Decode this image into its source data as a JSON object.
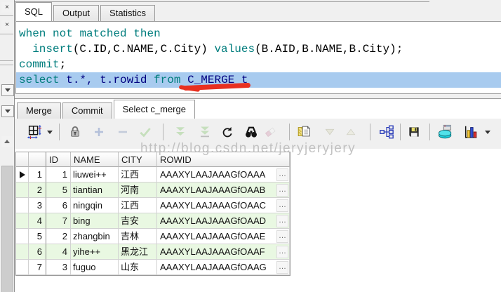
{
  "top_tabs": {
    "items": [
      {
        "label": "SQL",
        "active": true
      },
      {
        "label": "Output",
        "active": false
      },
      {
        "label": "Statistics",
        "active": false
      }
    ]
  },
  "editor": {
    "colors": {
      "keyword": "#007d7d",
      "identifier": "#000000",
      "selected_identifier": "#000080",
      "selection_bg": "#a8cbef",
      "marker_red": "#e83020"
    },
    "lines": [
      {
        "selected": false,
        "tokens": [
          [
            "when",
            "kw"
          ],
          [
            " ",
            "pl"
          ],
          [
            "not",
            "kw"
          ],
          [
            " ",
            "pl"
          ],
          [
            "matched",
            "kw"
          ],
          [
            " ",
            "pl"
          ],
          [
            "then",
            "kw"
          ]
        ]
      },
      {
        "selected": false,
        "tokens": [
          [
            "  ",
            "pl"
          ],
          [
            "insert",
            "kw"
          ],
          [
            "(C.ID,C.NAME,C.City) ",
            "pl"
          ],
          [
            "values",
            "kw"
          ],
          [
            "(B.AID,B.NAME,B.City);",
            "pl"
          ]
        ]
      },
      {
        "selected": false,
        "tokens": [
          [
            "commit",
            "kw"
          ],
          [
            ";",
            "pl"
          ]
        ]
      },
      {
        "selected": true,
        "tokens": [
          [
            "select",
            "kw"
          ],
          [
            " ",
            "nv"
          ],
          [
            "t.*, t.rowid ",
            "nv"
          ],
          [
            "from",
            "kw"
          ],
          [
            " ",
            "nv"
          ],
          [
            "C_MERGE t",
            "nv"
          ]
        ]
      }
    ],
    "annotation": {
      "shape": "hand-drawn-underline",
      "under_text": "C_MERGE"
    }
  },
  "result_tabs": {
    "items": [
      {
        "label": "Merge",
        "active": false
      },
      {
        "label": "Commit",
        "active": false
      },
      {
        "label": "Select c_merge",
        "active": true
      }
    ]
  },
  "toolbar": {
    "buttons": [
      {
        "icon": "grid-layout-icon",
        "enabled": true,
        "dropdown": true
      },
      {
        "icon": "lock-icon",
        "enabled": true
      },
      {
        "icon": "add-record-icon",
        "enabled": false
      },
      {
        "icon": "delete-record-icon",
        "enabled": false
      },
      {
        "icon": "post-changes-icon",
        "enabled": false
      },
      {
        "icon": "fetch-next-page-icon",
        "enabled": false
      },
      {
        "icon": "fetch-last-page-icon",
        "enabled": false
      },
      {
        "icon": "refresh-icon",
        "enabled": true
      },
      {
        "icon": "find-icon",
        "enabled": true
      },
      {
        "icon": "erase-icon",
        "enabled": false
      },
      {
        "icon": "copy-results-icon",
        "enabled": true
      },
      {
        "icon": "sort-descending-icon",
        "enabled": false
      },
      {
        "icon": "sort-ascending-icon",
        "enabled": false
      },
      {
        "icon": "single-record-view-icon",
        "enabled": true
      },
      {
        "icon": "save-results-icon",
        "enabled": true
      },
      {
        "icon": "export-results-icon",
        "enabled": true
      },
      {
        "icon": "chart-icon",
        "enabled": true,
        "dropdown": true
      }
    ]
  },
  "watermark": {
    "text": "http://blog.csdn.net/jeryjeryjery"
  },
  "grid": {
    "headers": [
      "ID",
      "NAME",
      "CITY",
      "ROWID"
    ],
    "stripe_color": "#e9f8e2",
    "current_row_marker": "right-triangle",
    "ellipsis_label": "…",
    "rows": [
      {
        "num": "1",
        "id": "1",
        "name": "liuwei++",
        "city": "江西",
        "rowid": "AAAXYLAAJAAAGfOAAA",
        "current": true,
        "striped": false
      },
      {
        "num": "2",
        "id": "5",
        "name": "tiantian",
        "city": "河南",
        "rowid": "AAAXYLAAJAAAGfOAAB",
        "current": false,
        "striped": true
      },
      {
        "num": "3",
        "id": "6",
        "name": "ningqin",
        "city": "江西",
        "rowid": "AAAXYLAAJAAAGfOAAC",
        "current": false,
        "striped": false
      },
      {
        "num": "4",
        "id": "7",
        "name": "bing",
        "city": "吉安",
        "rowid": "AAAXYLAAJAAAGfOAAD",
        "current": false,
        "striped": true
      },
      {
        "num": "5",
        "id": "2",
        "name": "zhangbin",
        "city": "吉林",
        "rowid": "AAAXYLAAJAAAGfOAAE",
        "current": false,
        "striped": false
      },
      {
        "num": "6",
        "id": "4",
        "name": "yihe++",
        "city": "黑龙江",
        "rowid": "AAAXYLAAJAAAGfOAAF",
        "current": false,
        "striped": true
      },
      {
        "num": "7",
        "id": "3",
        "name": "fuguo",
        "city": "山东",
        "rowid": "AAAXYLAAJAAAGfOAAG",
        "current": false,
        "striped": false
      }
    ]
  }
}
